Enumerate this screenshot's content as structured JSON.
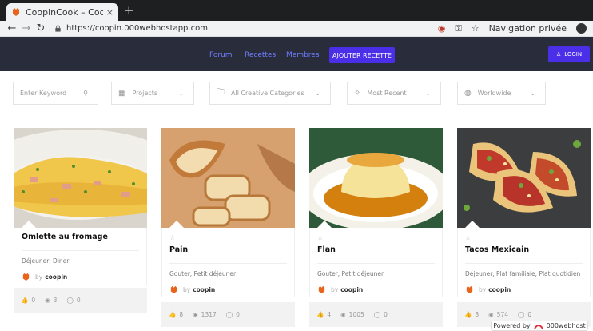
{
  "browser": {
    "tab_title": "CoopinCook – Coopératio",
    "tab_close": "×",
    "new_tab": "+",
    "url": "https://coopin.000webhostapp.com",
    "private_label": "Navigation privée",
    "icons": [
      "back-arrow-icon",
      "forward-arrow-icon",
      "reload-icon",
      "lock-icon",
      "extension-icon",
      "key-icon",
      "star-icon",
      "private-browsing-icon"
    ]
  },
  "nav": {
    "links": [
      "Forum",
      "Recettes",
      "Membres"
    ],
    "add_recipe": "AJOUTER RECETTE",
    "login": "LOGIN",
    "link_color": "#6f7dff",
    "accent": "#4b2ee8",
    "bg": "#292c3b"
  },
  "filters": {
    "keyword_placeholder": "Enter Keyword",
    "projects": "Projects",
    "categories": "All Creative Categories",
    "sort": "Most Recent",
    "region": "Worldwide"
  },
  "cards": [
    {
      "title": "Omlette au fromage",
      "categories": "Déjeuner, Diner",
      "by": "by",
      "author": "coopin",
      "likes": "0",
      "views": "3",
      "comments": "0",
      "show_star": false
    },
    {
      "title": "Pain",
      "categories": "Gouter, Petit déjeuner",
      "by": "by",
      "author": "coopin",
      "likes": "8",
      "views": "1317",
      "comments": "0",
      "show_star": true
    },
    {
      "title": "Flan",
      "categories": "Gouter, Petit déjeuner",
      "by": "by",
      "author": "coopin",
      "likes": "4",
      "views": "1005",
      "comments": "0",
      "show_star": true
    },
    {
      "title": "Tacos Mexicain",
      "categories": "Déjeuner, Plat familiale, Plat quotidien",
      "by": "by",
      "author": "coopin",
      "likes": "8",
      "views": "574",
      "comments": "0",
      "show_star": true
    }
  ],
  "powered": {
    "prefix": "Powered by",
    "brand": "000webhost"
  }
}
